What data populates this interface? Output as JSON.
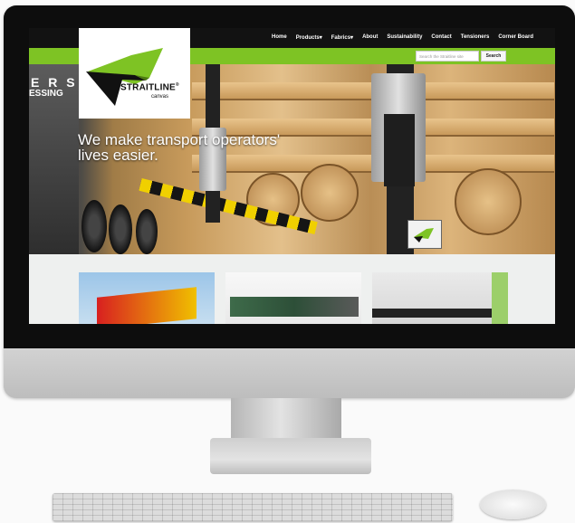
{
  "site": {
    "nav": [
      "Home",
      "Products▾",
      "Fabrics▾",
      "About",
      "Sustainability",
      "Contact",
      "Tensioners",
      "Corner Board"
    ],
    "search": {
      "placeholder": "Search the Straitline site",
      "button": "Search"
    },
    "logo": {
      "name": "STRAITLINE",
      "registered": "®",
      "sub": "canvas"
    },
    "hero": {
      "tagline": "We make transport operators' lives easier.",
      "background_text_1": "E R S",
      "background_text_2": "ESSING"
    }
  },
  "colors": {
    "accent_green": "#7ec324",
    "nav_bg": "#121212"
  }
}
